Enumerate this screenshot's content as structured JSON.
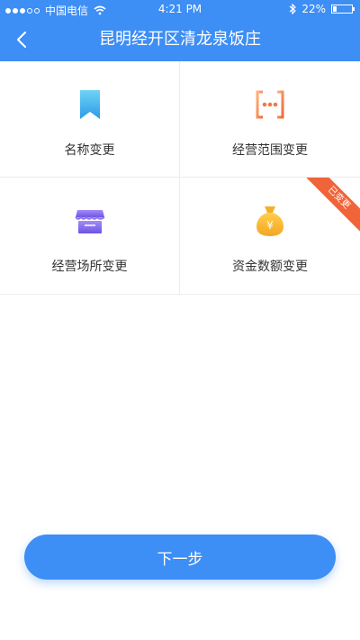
{
  "status_bar": {
    "carrier": "中国电信",
    "time": "4:21 PM",
    "battery": "22%",
    "battery_level": 0.22,
    "signal_bars_filled": 3
  },
  "nav": {
    "title": "昆明经开区清龙泉饭庄",
    "back_icon": "chevron-left-icon"
  },
  "options": [
    {
      "label": "名称变更",
      "icon": "bookmark-icon",
      "badge": ""
    },
    {
      "label": "经营范围变更",
      "icon": "brackets-icon",
      "badge": ""
    },
    {
      "label": "经营场所变更",
      "icon": "store-icon",
      "badge": ""
    },
    {
      "label": "资金数额变更",
      "icon": "money-bag-icon",
      "badge": "已变更"
    }
  ],
  "next_button": {
    "label": "下一步"
  },
  "colors": {
    "primary": "#3d8ef5",
    "ribbon": "#f0643a"
  }
}
